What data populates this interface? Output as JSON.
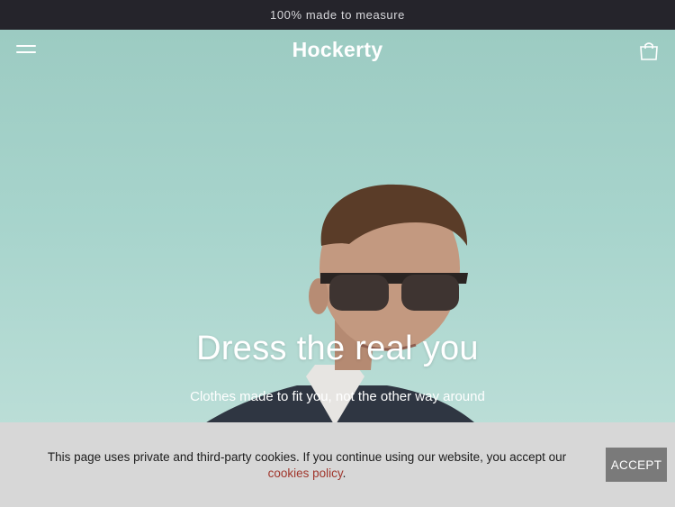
{
  "announcement": {
    "text": "100% made to measure"
  },
  "header": {
    "logo": "Hockerty"
  },
  "hero": {
    "title": "Dress the real you",
    "subtitle": "Clothes made to fit you, not the other way around"
  },
  "cookie_banner": {
    "text": "This page uses private and third-party cookies. If you continue using our website, you accept our",
    "link_label": "cookies policy",
    "trailing": ".",
    "accept_label": "ACCEPT"
  },
  "icons": {
    "menu": "hamburger-icon",
    "cart": "shopping-bag-icon"
  },
  "colors": {
    "announcement_bg": "#25242b",
    "hero_sky": "#a7d4cc",
    "cookie_bg": "#d7d7d7",
    "accept_bg": "#7a7a7a",
    "link": "#a0362c"
  }
}
